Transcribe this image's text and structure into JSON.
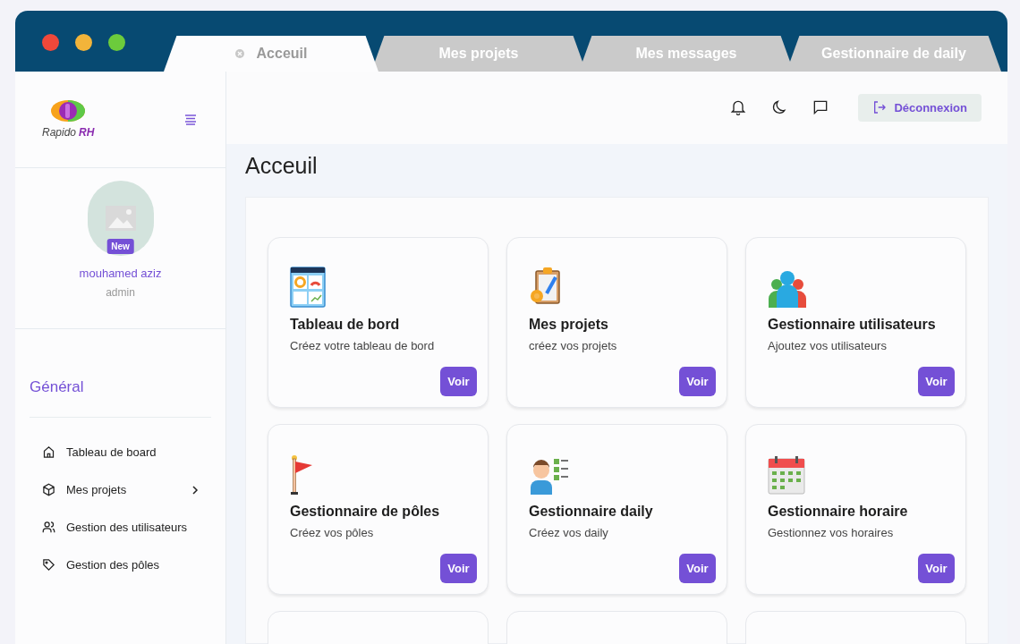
{
  "tabs": [
    {
      "label": "Acceuil",
      "selected": true
    },
    {
      "label": "Mes projets",
      "selected": false
    },
    {
      "label": "Mes messages",
      "selected": false
    },
    {
      "label": "Gestionnaire de daily",
      "selected": false
    }
  ],
  "logo": {
    "name": "Rapido",
    "suffix": "RH"
  },
  "header": {
    "logout": "Déconnexion"
  },
  "profile": {
    "badge": "New",
    "name": "mouhamed aziz",
    "role": "admin"
  },
  "sidebar": {
    "section": "Général",
    "items": [
      {
        "label": "Tableau de board",
        "kind": "home",
        "expandable": false
      },
      {
        "label": "Mes projets",
        "kind": "box",
        "expandable": true
      },
      {
        "label": "Gestion des utilisateurs",
        "kind": "users",
        "expandable": false
      },
      {
        "label": "Gestion des pôles",
        "kind": "tag",
        "expandable": false
      }
    ]
  },
  "page_title": "Acceuil",
  "cards": [
    {
      "kind": "dashboard",
      "title": "Tableau de bord",
      "subtitle": "Créez votre tableau de bord",
      "button": "Voir"
    },
    {
      "kind": "clipboard",
      "title": "Mes projets",
      "subtitle": "créez vos projets",
      "button": "Voir"
    },
    {
      "kind": "users",
      "title": "Gestionnaire utilisateurs",
      "subtitle": "Ajoutez vos utilisateurs",
      "button": "Voir"
    },
    {
      "kind": "flag",
      "title": "Gestionnaire de pôles",
      "subtitle": "Créez vos pôles",
      "button": "Voir"
    },
    {
      "kind": "person",
      "title": "Gestionnaire daily",
      "subtitle": "Créez vos daily",
      "button": "Voir"
    },
    {
      "kind": "calendar",
      "title": "Gestionnaire horaire",
      "subtitle": "Gestionnez vos horaires",
      "button": "Voir"
    }
  ]
}
